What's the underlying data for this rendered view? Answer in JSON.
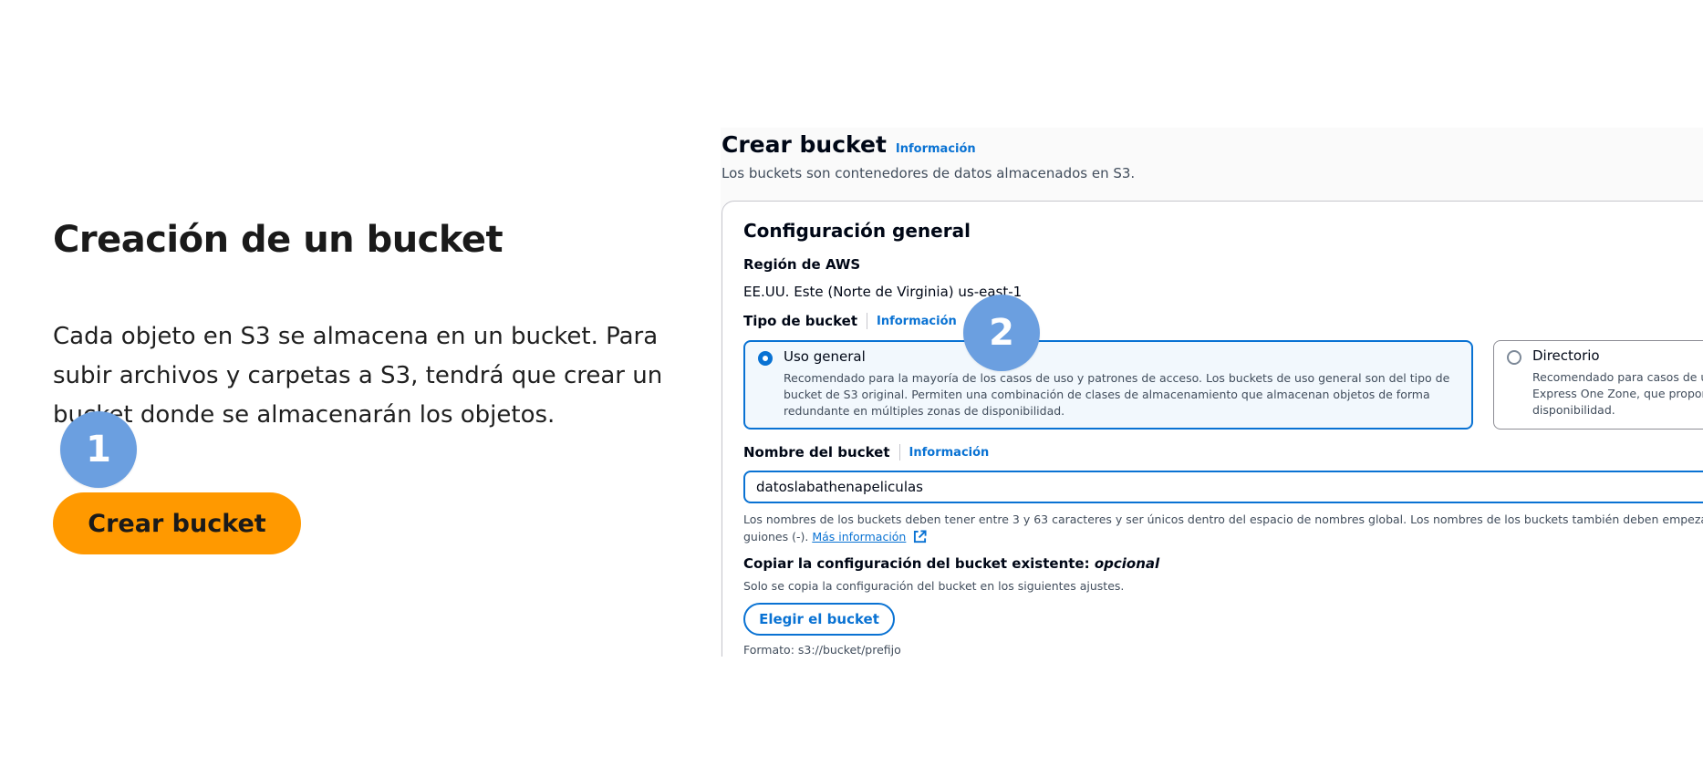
{
  "left": {
    "title": "Creación de un bucket",
    "description": "Cada objeto en S3 se almacena en un bucket. Para subir archivos y carpetas a S3, tendrá que crear un bucket donde se almacenarán los objetos.",
    "button_label": "Crear bucket"
  },
  "steps": {
    "step1": "1",
    "step2": "2",
    "color": "#6b9fe0"
  },
  "console": {
    "title": "Crear bucket",
    "title_info": "Información",
    "subtitle": "Los buckets son contenedores de datos almacenados en S3.",
    "general": {
      "title": "Configuración general",
      "region_label": "Región de AWS",
      "region_value": "EE.UU. Este (Norte de Virginia) us-east-1",
      "bucket_type_label": "Tipo de bucket",
      "bucket_type_info": "Información",
      "options": [
        {
          "label": "Uso general",
          "selected": true,
          "description": "Recomendado para la mayoría de los casos de uso y patrones de acceso. Los buckets de uso general son del tipo de bucket de S3 original. Permiten una combinación de clases de almacenamiento que almacenan objetos de forma redundante en múltiples zonas de disponibilidad."
        },
        {
          "label": "Directorio",
          "selected": false,
          "description_lines": [
            "Recomendado para casos de u",
            "Express One Zone, que propor",
            "disponibilidad."
          ]
        }
      ],
      "bucket_name_label": "Nombre del bucket",
      "bucket_name_info": "Información",
      "bucket_name_value": "datoslabathenapeliculas",
      "bucket_name_help_line1": "Los nombres de los buckets deben tener entre 3 y 63 caracteres y ser únicos dentro del espacio de nombres global. Los nombres de los buckets también deben empezar y",
      "bucket_name_help_line2": "guiones (-).",
      "more_info_link": "Más información",
      "copy_label": "Copiar la configuración del bucket existente:",
      "copy_label_optional": "opcional",
      "copy_desc": "Solo se copia la configuración del bucket en los siguientes ajustes.",
      "choose_bucket_button": "Elegir el bucket",
      "format_text": "Formato: s3://bucket/prefijo"
    }
  },
  "colors": {
    "primary_button": "#ff9900",
    "link": "#0972d3",
    "selected_tile_bg": "#f2f8fd"
  },
  "icons": {
    "external_link": "external-link-icon"
  }
}
